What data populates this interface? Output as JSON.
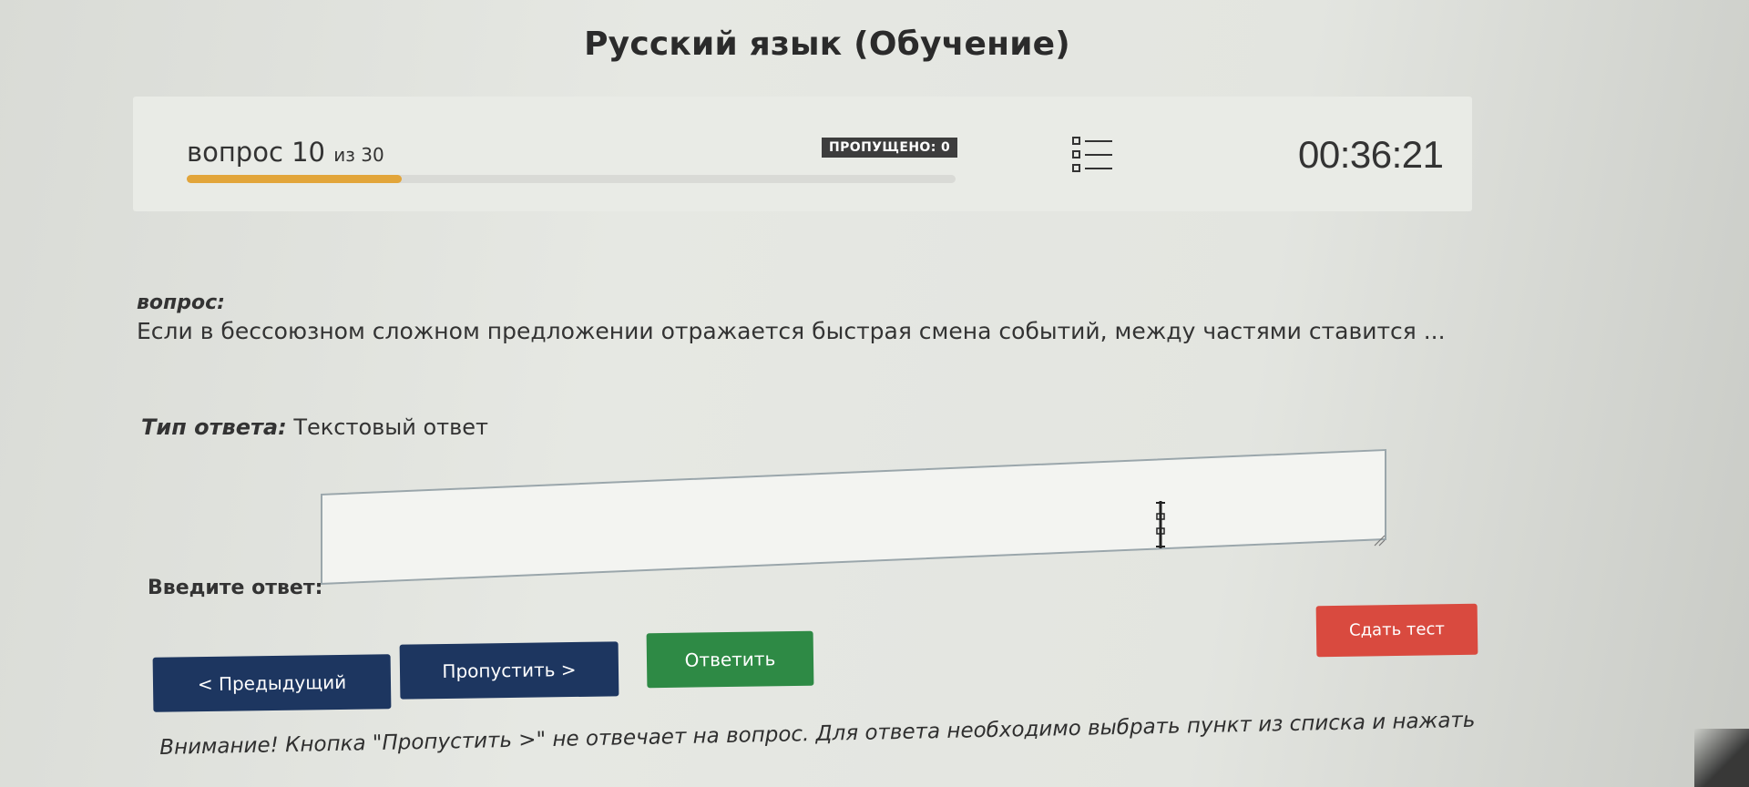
{
  "header": {
    "title": "Русский язык (Обучение)"
  },
  "status": {
    "question_word": "вопрос",
    "question_number": "10",
    "question_total_text": "из 30",
    "progress": 0.28,
    "skipped_label": "ПРОПУЩЕНО: 0",
    "timer": "00:36:21",
    "list_icon": "question-list-icon"
  },
  "question": {
    "heading": "вопрос:",
    "text": "Если в бессоюзном сложном предложении отражается быстрая смена событий, между частями ставится ..."
  },
  "answer_type": {
    "label": "Тип ответа:",
    "value": "Текстовый ответ"
  },
  "answer": {
    "label": "Введите ответ:",
    "value": ""
  },
  "buttons": {
    "prev": "< Предыдущий",
    "skip": "Пропустить >",
    "answer": "Ответить",
    "finish": "Сдать тест"
  },
  "notice": {
    "text": "Внимание! Кнопка \"Пропустить >\" не отвечает на вопрос. Для ответа необходимо выбрать пункт из списка и нажать"
  },
  "colors": {
    "progress": "#e2a53a",
    "nav_button": "#1d3660",
    "answer_button": "#2e8a45",
    "finish_button": "#d94a3f",
    "badge": "#3d3d3d"
  }
}
